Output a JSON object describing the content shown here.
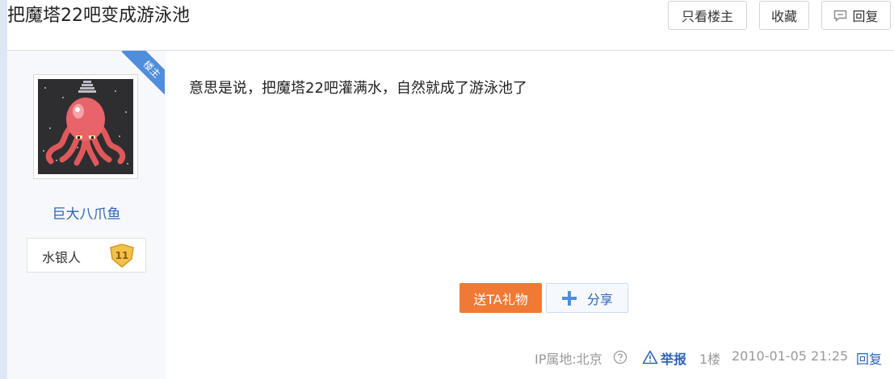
{
  "header": {
    "title": "把魔塔22吧变成游泳池",
    "only_op_label": "只看楼主",
    "favorite_label": "收藏",
    "reply_label": "回复"
  },
  "author": {
    "username": "巨大八爪鱼",
    "level_name": "水银人",
    "level": "11",
    "op_ribbon": "楼主"
  },
  "post": {
    "content": "意思是说，把魔塔22吧灌满水，自然就成了游泳池了",
    "gift_label": "送TA礼物",
    "share_label": "分享"
  },
  "footer": {
    "ip_location": "IP属地:北京",
    "report_label": "举报",
    "floor": "1楼",
    "timestamp": "2010-01-05 21:25",
    "reply_label": "回复"
  },
  "colors": {
    "link_blue": "#2d64b3",
    "gift_orange": "#f07a35",
    "ribbon_blue": "#4f8ddd",
    "badge_gold": "#f2c14a"
  },
  "icons": {
    "reply": "speech-bubble-icon",
    "share": "plus-icon",
    "help": "question-circle-icon",
    "report": "warning-triangle-icon"
  }
}
